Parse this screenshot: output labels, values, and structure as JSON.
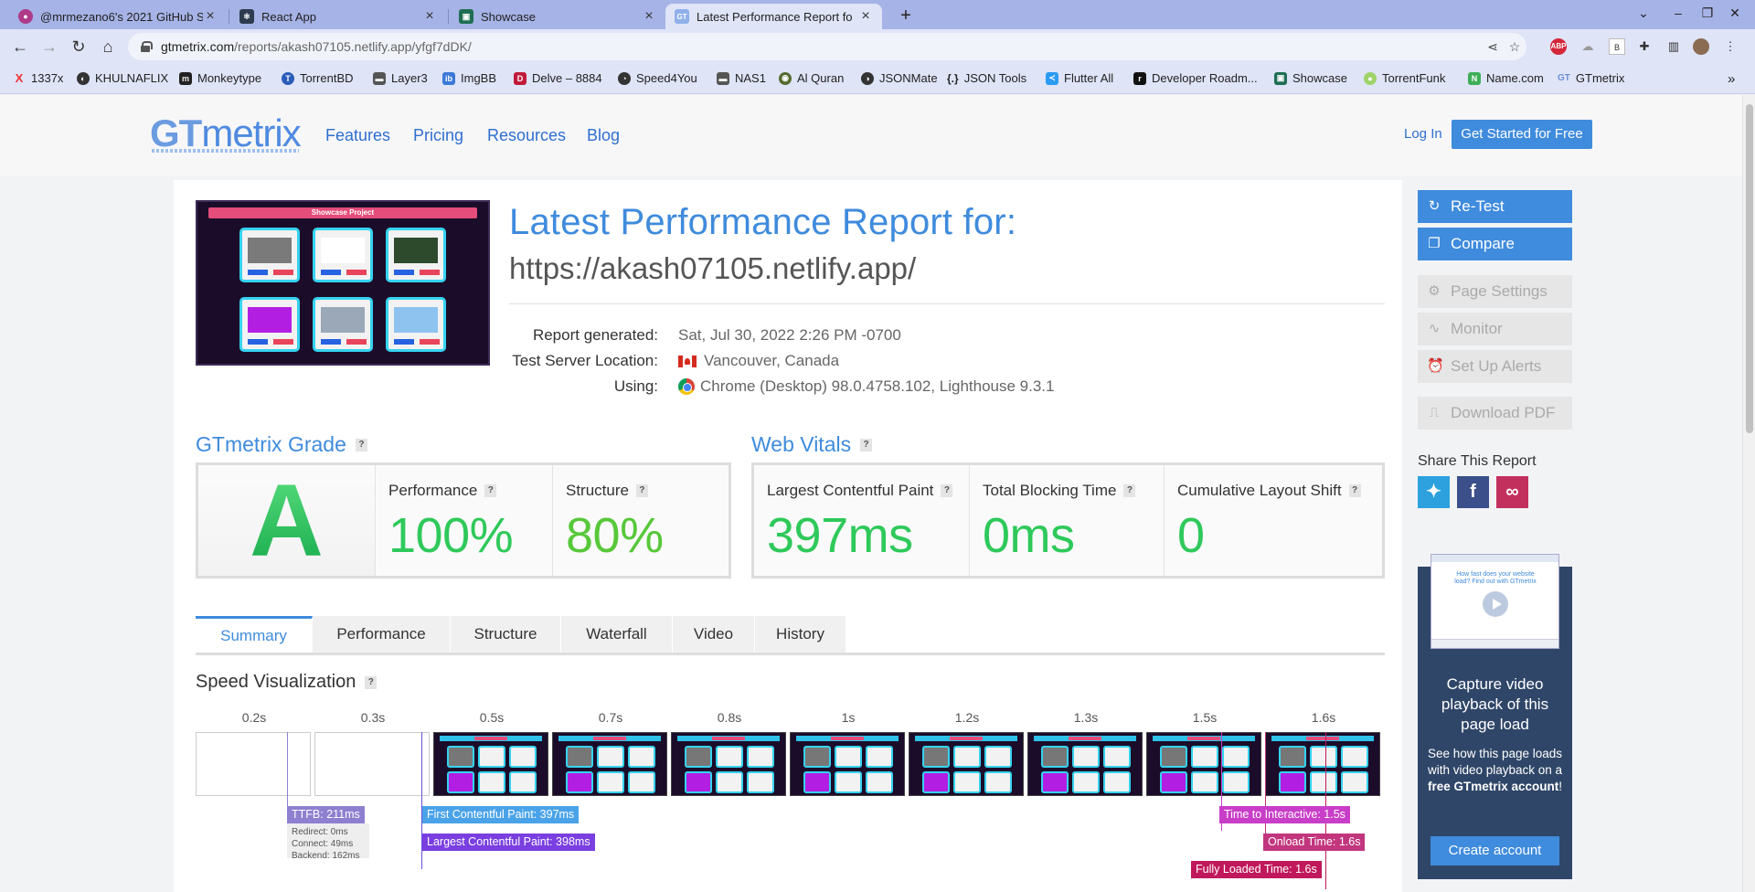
{
  "browser": {
    "tabs": [
      {
        "title": "@mrmezano6's 2021 GitHub S",
        "favicon": "github"
      },
      {
        "title": "React App",
        "favicon": "react"
      },
      {
        "title": "Showcase",
        "favicon": "showcase"
      },
      {
        "title": "Latest Performance Report fo",
        "favicon": "GT"
      }
    ],
    "url_host": "gtmetrix.com",
    "url_path": "/reports/akash07105.netlify.app/yfgf7dDK/",
    "bookmarks": [
      "1337x",
      "KHULNAFLIX",
      "Monkeytype",
      "TorrentBD",
      "Layer3",
      "ImgBB",
      "Delve – 8884",
      "Speed4You",
      "NAS1",
      "Al Quran",
      "JSONMate",
      "JSON Tools",
      "Flutter All",
      "Developer Roadm...",
      "Showcase",
      "TorrentFunk",
      "Name.com",
      "GTmetrix"
    ]
  },
  "header": {
    "logo_gt": "GT",
    "logo_metrix": "metrix",
    "nav": [
      "Features",
      "Pricing",
      "Resources",
      "Blog"
    ],
    "login": "Log In",
    "cta": "Get Started for Free"
  },
  "report": {
    "screenshot_title": "Showcase Project",
    "title": "Latest Performance Report for:",
    "url": "https://akash07105.netlify.app/",
    "meta": [
      {
        "label": "Report generated:",
        "value": "Sat, Jul 30, 2022 2:26 PM -0700"
      },
      {
        "label": "Test Server Location:",
        "value": "Vancouver, Canada"
      },
      {
        "label": "Using:",
        "value": "Chrome (Desktop) 98.0.4758.102, Lighthouse 9.3.1"
      }
    ]
  },
  "grade": {
    "heading": "GTmetrix Grade",
    "help": "?",
    "letter": "A",
    "performance_label": "Performance",
    "performance_value": "100%",
    "structure_label": "Structure",
    "structure_value": "80%"
  },
  "vitals": {
    "heading": "Web Vitals",
    "help": "?",
    "items": [
      {
        "label": "Largest Contentful Paint",
        "value": "397ms"
      },
      {
        "label": "Total Blocking Time",
        "value": "0ms"
      },
      {
        "label": "Cumulative Layout Shift",
        "value": "0"
      }
    ]
  },
  "tabs": [
    "Summary",
    "Performance",
    "Structure",
    "Waterfall",
    "Video",
    "History"
  ],
  "speed": {
    "heading": "Speed Visualization",
    "times": [
      "0.2s",
      "0.3s",
      "0.5s",
      "0.7s",
      "0.8s",
      "1s",
      "1.2s",
      "1.3s",
      "1.5s",
      "1.6s"
    ],
    "markers": {
      "ttfb": "TTFB: 211ms",
      "redirect": "Redirect: 0ms",
      "connect": "Connect: 49ms",
      "backend": "Backend: 162ms",
      "fcp": "First Contentful Paint: 397ms",
      "lcp": "Largest Contentful Paint: 398ms",
      "tti": "Time to Interactive: 1.5s",
      "onload": "Onload Time: 1.6s",
      "fully": "Fully Loaded Time: 1.6s"
    }
  },
  "sidebar": {
    "retest": "Re-Test",
    "compare": "Compare",
    "page_settings": "Page Settings",
    "monitor": "Monitor",
    "alerts": "Set Up Alerts",
    "pdf": "Download PDF",
    "share": "Share This Report",
    "promo_shot_heading": "How fast does your website load? Find out with GTmetrix",
    "promo_heading": "Capture video playback of this page load",
    "promo_text_1": "See how this page loads with video playback on a ",
    "promo_text_bold_1": "free GTmetrix account",
    "promo_text_2": "!",
    "promo_cta": "Create account"
  },
  "colors": {
    "brand_blue": "#3f8bdd",
    "grade_green": "#22c35e",
    "good_green": "#2ec95a",
    "ok_green": "#57c83a",
    "ttfb": "#8f7fd0",
    "fcp": "#4aa3e8",
    "lcp": "#7a3fe0",
    "tti": "#c93ec8",
    "onload": "#c2367e",
    "fully": "#c0185a"
  }
}
